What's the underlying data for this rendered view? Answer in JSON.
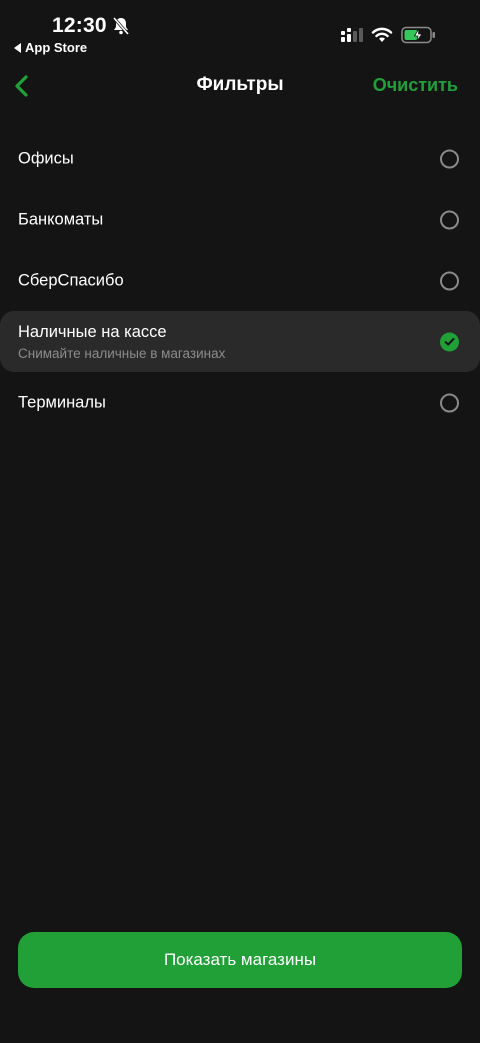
{
  "status_bar": {
    "time": "12:30",
    "back_app": "App Store",
    "icons": [
      "bell-muted-icon",
      "signal-icon",
      "wifi-icon",
      "battery-charging-icon"
    ]
  },
  "nav": {
    "back_icon": "chevron-left-icon",
    "title": "Фильтры",
    "clear_label": "Очистить"
  },
  "filters": [
    {
      "label": "Офисы",
      "subtitle": "",
      "selected": false
    },
    {
      "label": "Банкоматы",
      "subtitle": "",
      "selected": false
    },
    {
      "label": "СберСпасибо",
      "subtitle": "",
      "selected": false
    },
    {
      "label": "Наличные на кассе",
      "subtitle": "Снимайте наличные в магазинах",
      "selected": true
    },
    {
      "label": "Терминалы",
      "subtitle": "",
      "selected": false
    }
  ],
  "footer": {
    "button_label": "Показать магазины"
  },
  "colors": {
    "background": "#141414",
    "accent": "#21a038",
    "selected_row": "#2a2a2a",
    "subtitle": "#8c8c8c"
  }
}
